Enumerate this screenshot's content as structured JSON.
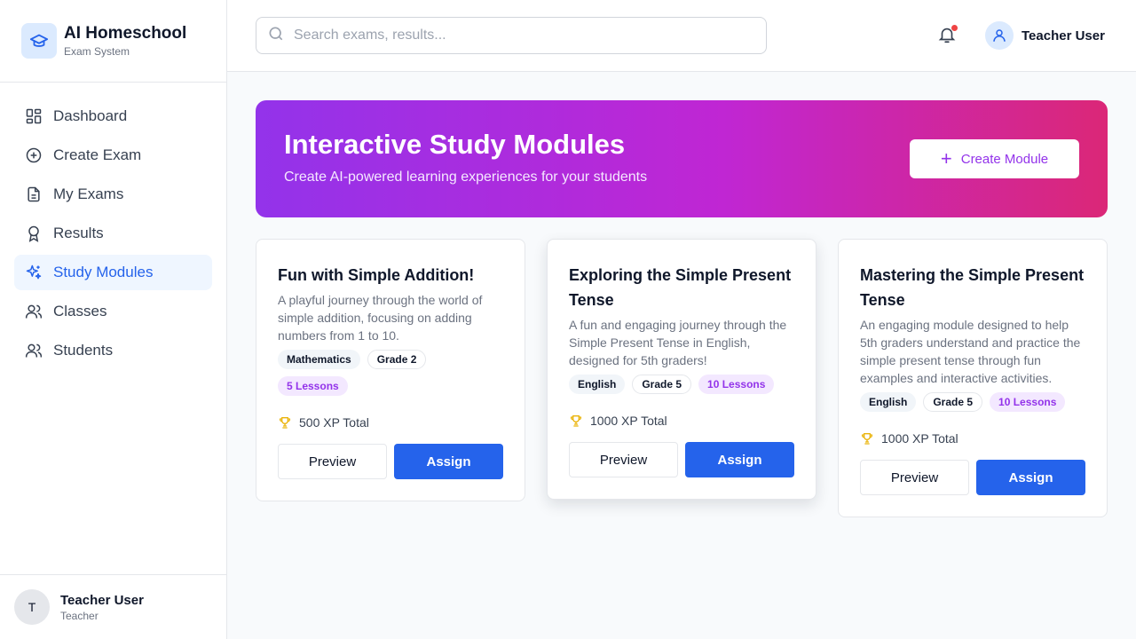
{
  "brand": {
    "title": "AI Homeschool",
    "subtitle": "Exam System",
    "icon": "graduation-cap-icon"
  },
  "sidebar": {
    "items": [
      {
        "label": "Dashboard",
        "icon": "dashboard-icon",
        "active": false
      },
      {
        "label": "Create Exam",
        "icon": "plus-circle-icon",
        "active": false
      },
      {
        "label": "My Exams",
        "icon": "document-icon",
        "active": false
      },
      {
        "label": "Results",
        "icon": "award-icon",
        "active": false
      },
      {
        "label": "Study Modules",
        "icon": "sparkles-icon",
        "active": true
      },
      {
        "label": "Classes",
        "icon": "users-icon",
        "active": false
      },
      {
        "label": "Students",
        "icon": "users-icon",
        "active": false
      }
    ],
    "user": {
      "initial": "T",
      "name": "Teacher User",
      "role": "Teacher"
    }
  },
  "header": {
    "search_placeholder": "Search exams, results...",
    "user_name": "Teacher User",
    "has_notification": true
  },
  "hero": {
    "title": "Interactive Study Modules",
    "subtitle": "Create AI-powered learning experiences for your students",
    "button_label": "Create Module"
  },
  "modules": [
    {
      "title": "Fun with Simple Addition!",
      "description": "A playful journey through the world of simple addition, focusing on adding numbers from 1 to 10.",
      "subject": "Mathematics",
      "grade": "Grade 2",
      "lessons": "5 Lessons",
      "xp": "500 XP Total",
      "preview_label": "Preview",
      "assign_label": "Assign"
    },
    {
      "title": "Exploring the Simple Present Tense",
      "description": "A fun and engaging journey through the Simple Present Tense in English, designed for 5th graders!",
      "subject": "English",
      "grade": "Grade 5",
      "lessons": "10 Lessons",
      "xp": "1000 XP Total",
      "preview_label": "Preview",
      "assign_label": "Assign"
    },
    {
      "title": "Mastering the Simple Present Tense",
      "description": "An engaging module designed to help 5th graders understand and practice the simple present tense through fun examples and interactive activities.",
      "subject": "English",
      "grade": "Grade 5",
      "lessons": "10 Lessons",
      "xp": "1000 XP Total",
      "preview_label": "Preview",
      "assign_label": "Assign"
    }
  ],
  "colors": {
    "accent": "#2563eb",
    "purple": "#9333ea",
    "pink": "#db2777",
    "trophy": "#eab308"
  }
}
